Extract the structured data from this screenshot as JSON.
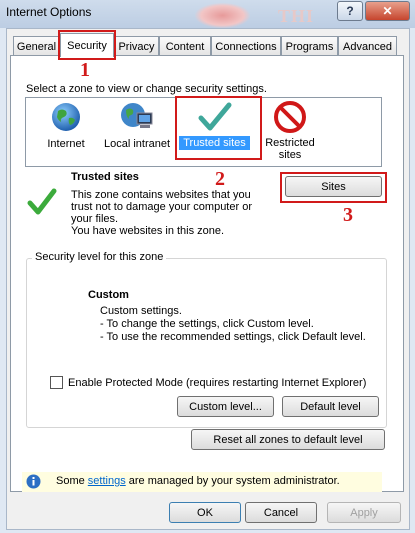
{
  "window": {
    "title": "Internet Options",
    "help_label": "?",
    "close_label": "✕",
    "watermark": "THI"
  },
  "tabs": [
    "General",
    "Security",
    "Privacy",
    "Content",
    "Connections",
    "Programs",
    "Advanced"
  ],
  "annotations": {
    "n1": "1",
    "n2": "2",
    "n3": "3"
  },
  "zone_prompt": "Select a zone to view or change security settings.",
  "zones": [
    {
      "name": "Internet",
      "icon": "globe-icon"
    },
    {
      "name": "Local intranet",
      "icon": "network-computer-icon"
    },
    {
      "name": "Trusted sites",
      "icon": "checkmark-icon"
    },
    {
      "name": "Restricted\nsites",
      "icon": "no-entry-icon"
    }
  ],
  "zone_info": {
    "title": "Trusted sites",
    "desc_lines": [
      "This zone contains websites that you",
      "trust not to damage your computer or",
      "your files.",
      "You have websites in this zone."
    ],
    "sites_button": "Sites"
  },
  "security_level": {
    "group_label": "Security level for this zone",
    "title": "Custom",
    "lines": [
      "Custom settings.",
      "- To change the settings, click Custom level.",
      "- To use the recommended settings, click Default level."
    ],
    "protected_mode": "Enable Protected Mode (requires restarting Internet Explorer)",
    "protected_mode_checked": false,
    "custom_level_button": "Custom level...",
    "default_level_button": "Default level"
  },
  "reset_button": "Reset all zones to default level",
  "info": {
    "prefix": "Some ",
    "link": "settings",
    "suffix": " are managed by your system administrator."
  },
  "footer": {
    "ok": "OK",
    "cancel": "Cancel",
    "apply": "Apply"
  },
  "colors": {
    "accent": "#3399ff",
    "annotation_red": "#d11a1a",
    "check_green": "#3cab3c",
    "info_bg": "#fffde0"
  }
}
